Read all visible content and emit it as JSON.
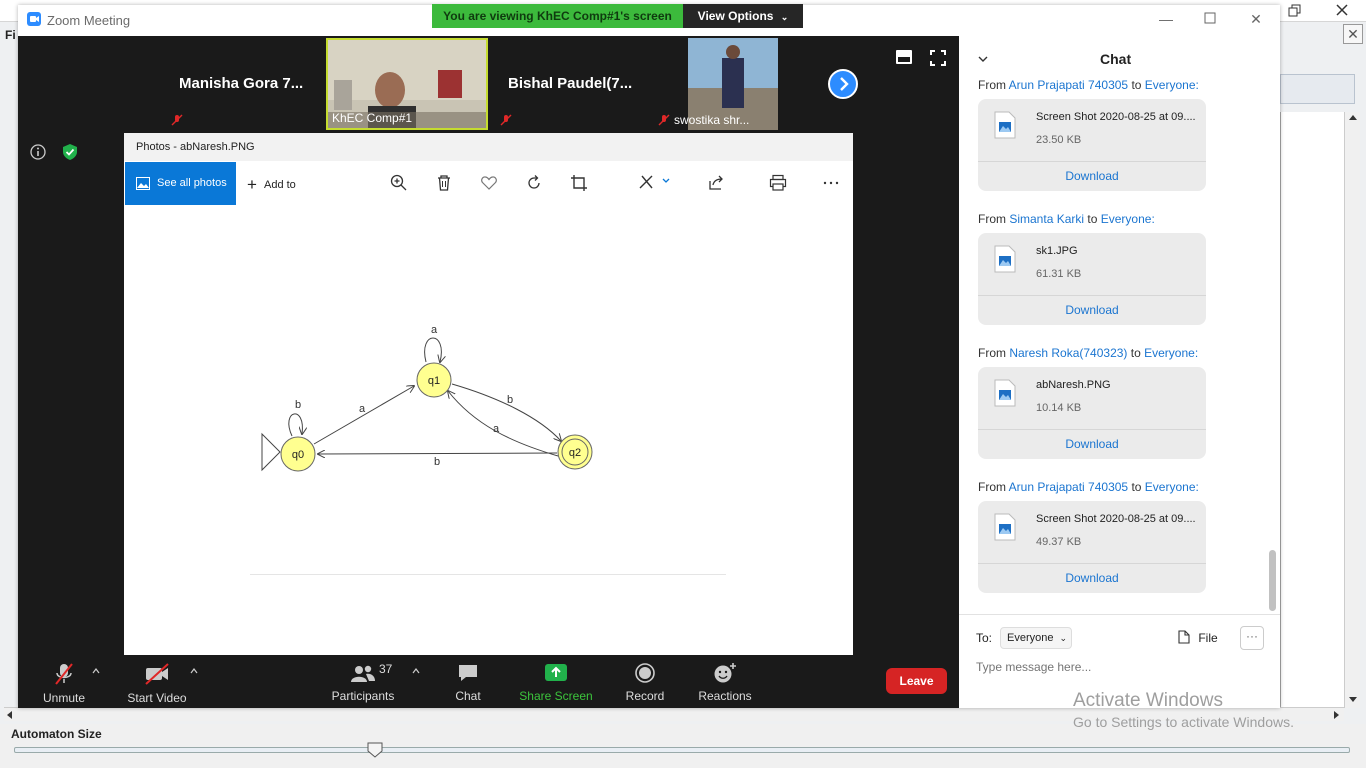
{
  "background_app": {
    "menu_label": "Fi",
    "close_glyph": "✕",
    "automaton_label": "Automaton Size",
    "slider_value": 0.27
  },
  "watermark": {
    "line1": "Activate Windows",
    "line2": "Go to Settings to activate Windows."
  },
  "zoom": {
    "title": "Zoom Meeting",
    "banner": "You are viewing KhEC Comp#1's screen",
    "view_options": "View Options",
    "participants_tiles": [
      {
        "name": "Manisha Gora 7...",
        "muted": true
      },
      {
        "label": "KhEC Comp#1",
        "muted": false
      },
      {
        "name": "Bishal Paudel(7...",
        "muted": true
      },
      {
        "label": "swostika shr...",
        "muted": true
      }
    ],
    "toolbar": {
      "unmute": "Unmute",
      "start_video": "Start Video",
      "participants": "Participants",
      "participants_count": "37",
      "chat": "Chat",
      "share_screen": "Share Screen",
      "record": "Record",
      "reactions": "Reactions",
      "leave": "Leave"
    }
  },
  "photos": {
    "title": "Photos - abNaresh.PNG",
    "see_all": "See all photos",
    "add_to": "Add to",
    "diagram": {
      "states": [
        "q0",
        "q1",
        "q2"
      ],
      "transition_labels": [
        "a",
        "b",
        "a",
        "b",
        "a",
        "b"
      ]
    }
  },
  "chat": {
    "title": "Chat",
    "messages": [
      {
        "from": "Arun Prajapati 740305",
        "to_word": "to",
        "to": "Everyone:",
        "prefix": "From",
        "file": "Screen Shot 2020-08-25 at 09....",
        "size": "23.50 KB",
        "download": "Download"
      },
      {
        "from": "Simanta Karki",
        "to_word": "to",
        "to": "Everyone:",
        "prefix": "From",
        "file": "sk1.JPG",
        "size": "61.31 KB",
        "download": "Download"
      },
      {
        "from": "Naresh Roka(740323)",
        "to_word": "to",
        "to": "Everyone:",
        "prefix": "From",
        "file": "abNaresh.PNG",
        "size": "10.14 KB",
        "download": "Download"
      },
      {
        "from": "Arun Prajapati 740305",
        "to_word": "to",
        "to": "Everyone:",
        "prefix": "From",
        "file": "Screen Shot 2020-08-25 at 09....",
        "size": "49.37 KB",
        "download": "Download"
      }
    ],
    "to_label": "To:",
    "to_value": "Everyone",
    "file_label": "File",
    "more_glyph": "···",
    "input_placeholder": "Type message here..."
  },
  "colors": {
    "zoom_blue": "#2d8cff",
    "banner_green": "#3cba3c",
    "leave_red": "#d62424",
    "link_blue": "#1b75d0"
  }
}
